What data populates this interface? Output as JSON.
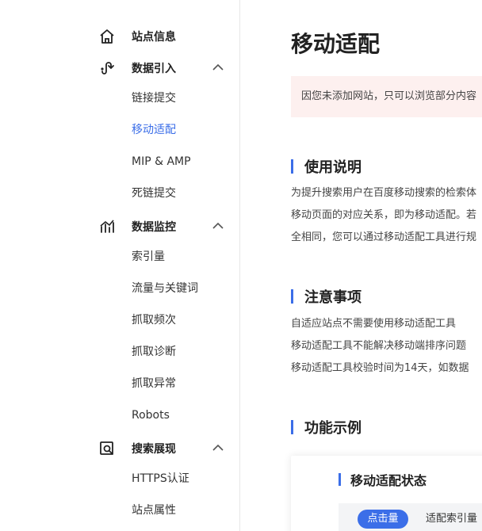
{
  "sidebar": {
    "top_item": {
      "label": "站点信息",
      "icon": "home-icon"
    },
    "groups": [
      {
        "label": "数据引入",
        "icon": "data-import-icon",
        "items": [
          "链接提交",
          "移动适配",
          "MIP & AMP",
          "死链提交"
        ],
        "active_index": 1
      },
      {
        "label": "数据监控",
        "icon": "data-monitor-icon",
        "items": [
          "索引量",
          "流量与关键词",
          "抓取频次",
          "抓取诊断",
          "抓取异常",
          "Robots"
        ]
      },
      {
        "label": "搜索展现",
        "icon": "search-display-icon",
        "items": [
          "HTTPS认证",
          "站点属性"
        ]
      }
    ]
  },
  "main": {
    "title": "移动适配",
    "notice": "因您未添加网站，只可以浏览部分内容",
    "sections": [
      {
        "title": "使用说明",
        "lines": [
          "为提升搜索用户在百度移动搜索的检索体",
          "移动页面的对应关系，即为移动适配。若",
          "全相同，您可以通过移动适配工具进行规"
        ]
      },
      {
        "title": "注意事项",
        "lines": [
          "自适应站点不需要使用移动适配工具",
          "移动适配工具不能解决移动端排序问题",
          "移动适配工具校验时间为14天，如数据"
        ]
      },
      {
        "title": "功能示例",
        "lines": []
      }
    ],
    "example_card": {
      "title": "移动适配状态",
      "tabs": [
        "点击量",
        "适配索引量"
      ],
      "active_tab": 0
    }
  },
  "colors": {
    "accent": "#3b6ee8",
    "notice_bg": "#fdf0ef"
  }
}
